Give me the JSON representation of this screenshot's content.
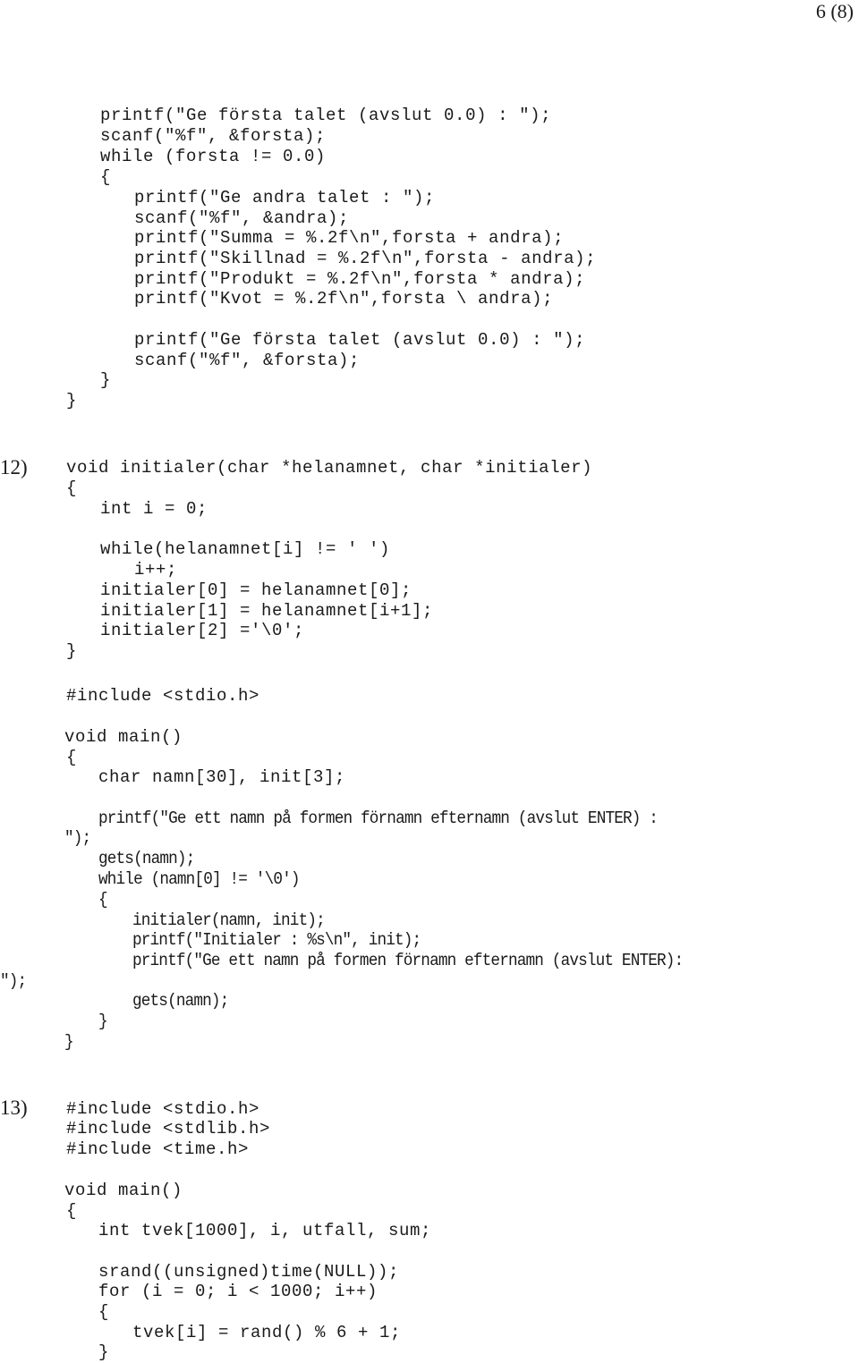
{
  "page_number": "6 (8)",
  "section_11_tail": {
    "lines": [
      "printf(″Ge första talet (avslut 0.0) : ″);",
      "scanf(″%f″, &forsta);",
      "while (forsta != 0.0)",
      "{",
      "printf(″Ge andra talet : ″);",
      "scanf(″%f″, &andra);",
      "printf(″Summa = %.2f\\n″,forsta + andra);",
      "printf(″Skillnad = %.2f\\n″,forsta - andra);",
      "printf(″Produkt = %.2f\\n″,forsta * andra);",
      "printf(″Kvot = %.2f\\n″,forsta \\ andra);",
      "printf(″Ge första talet (avslut 0.0) : ″);",
      "scanf(″%f″, &forsta);",
      "}",
      "}"
    ]
  },
  "section_12": {
    "number": "12)",
    "lines": [
      "void initialer(char *helanamnet, char *initialer)",
      "{",
      "int i = 0;",
      "while(helanamnet[i] != ′ ′)",
      "i++;",
      "initialer[0] = helanamnet[0];",
      "initialer[1] = helanamnet[i+1];",
      "initialer[2] =′\\0′;",
      "}",
      "#include <stdio.h>",
      "void main()",
      "{",
      "char namn[30], init[3];",
      "printf(″Ge ett namn på formen förnamn efternamn (avslut ENTER) :",
      "″);",
      "gets(namn);",
      "while (namn[0] != ′\\0′)",
      "{",
      "initialer(namn, init);",
      "printf(″Initialer : %s\\n″, init);",
      "printf(″Ge ett namn på formen förnamn efternamn (avslut ENTER):",
      "″);",
      "gets(namn);",
      "}",
      "}"
    ]
  },
  "section_13": {
    "number": "13)",
    "lines": [
      "#include <stdio.h>",
      "#include <stdlib.h>",
      "#include <time.h>",
      "void main()",
      "{",
      "int tvek[1000], i, utfall, sum;",
      "srand((unsigned)time(NULL));",
      "for (i = 0; i < 1000; i++)",
      "{",
      "tvek[i] = rand() % 6 + 1;",
      "}"
    ]
  }
}
